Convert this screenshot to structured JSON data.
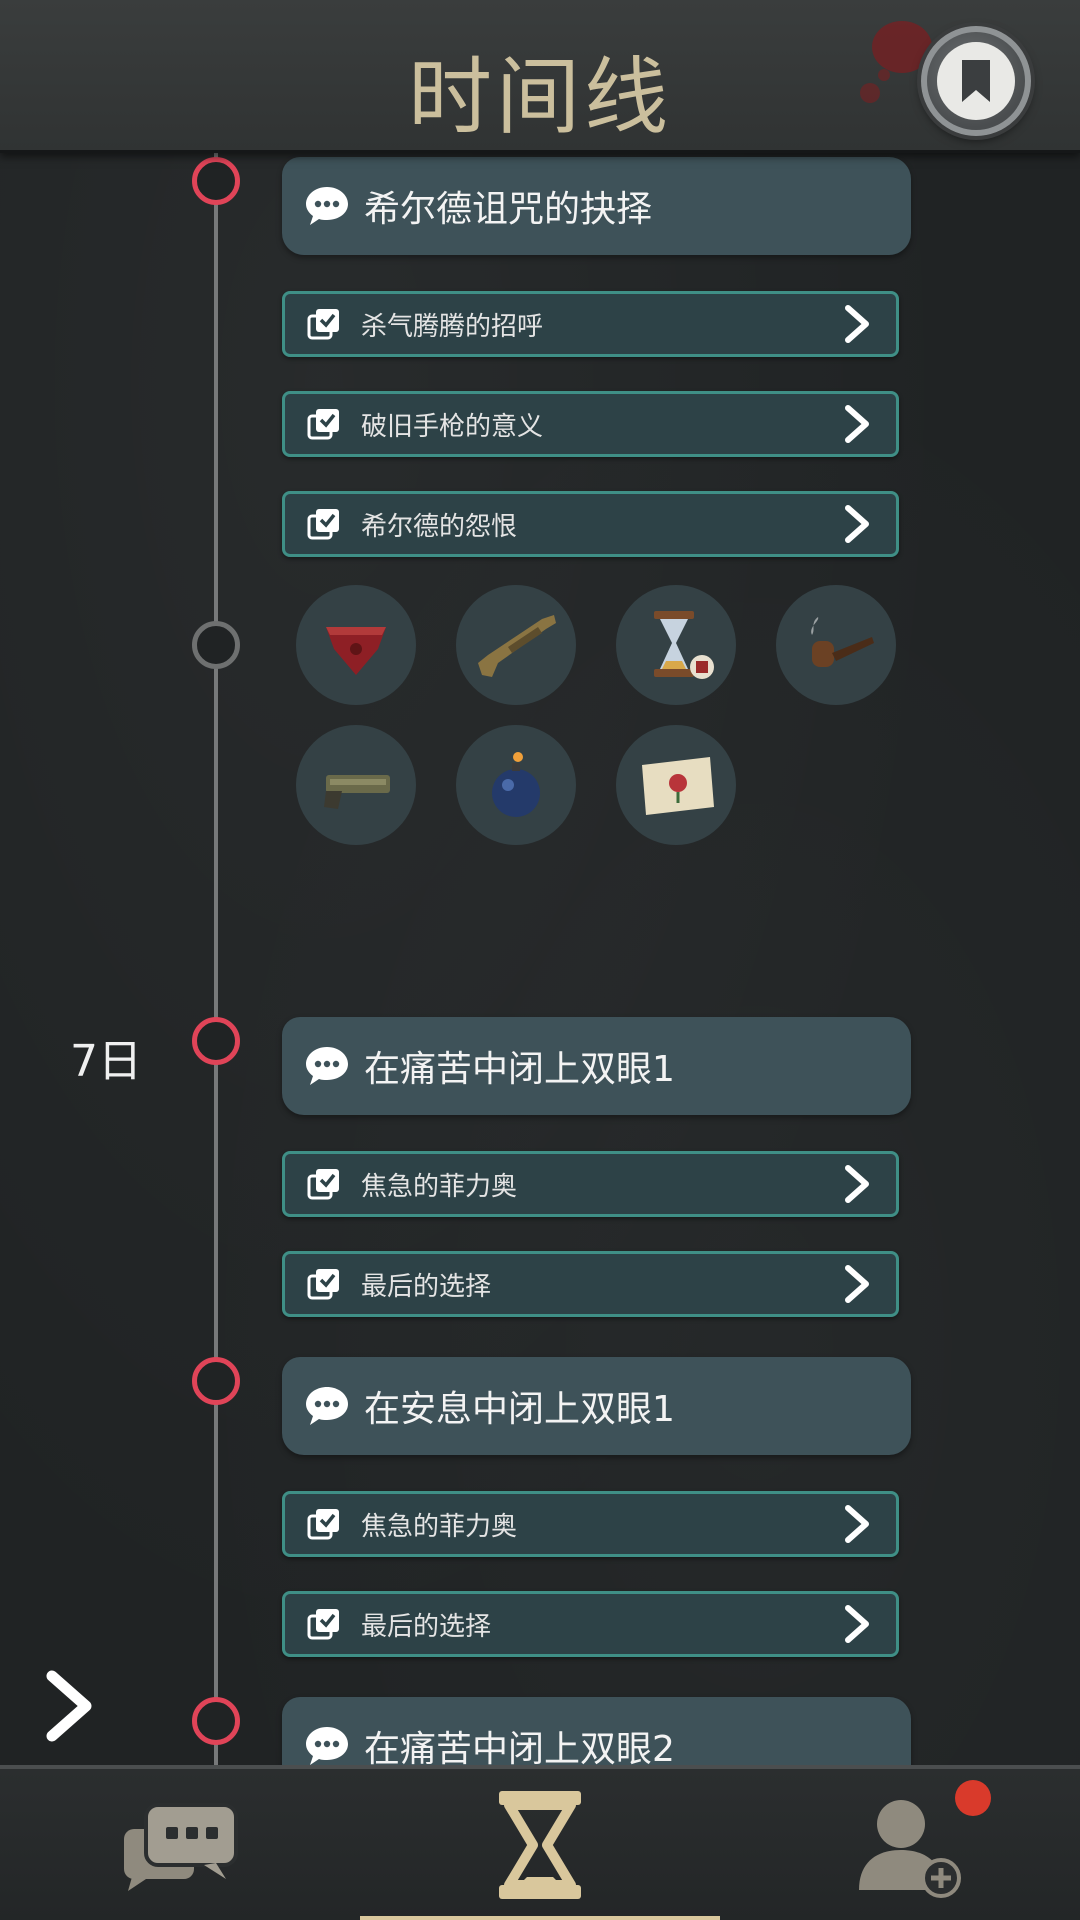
{
  "header": {
    "title": "时间线",
    "bookmark_icon": "bookmark-icon"
  },
  "timeline": {
    "days": [
      {
        "label": "7日"
      }
    ],
    "events": [
      {
        "title": "希尔德诅咒的抉择",
        "choices": [
          "杀气腾腾的招呼",
          "破旧手枪的意义",
          "希尔德的怨恨"
        ]
      },
      {
        "title": "在痛苦中闭上双眼1",
        "choices": [
          "焦急的菲力奥",
          "最后的选择"
        ]
      },
      {
        "title": "在安息中闭上双眼1",
        "choices": [
          "焦急的菲力奥",
          "最后的选择"
        ]
      },
      {
        "title": "在痛苦中闭上双眼2",
        "choices": []
      }
    ],
    "items": [
      "bandana-icon",
      "shotgun-icon",
      "hourglass-icon",
      "pipe-icon",
      "pistol-icon",
      "bomb-icon",
      "map-icon"
    ]
  },
  "bottom_nav": {
    "tabs": [
      "chat-icon",
      "hourglass-icon",
      "add-contact-icon"
    ],
    "active": "hourglass-icon"
  },
  "colors": {
    "accent": "#d9c79c",
    "node_active": "#e04458",
    "choice_border": "#3f8f86",
    "event_bg": "#3e5259",
    "notification": "#d93a2b"
  }
}
